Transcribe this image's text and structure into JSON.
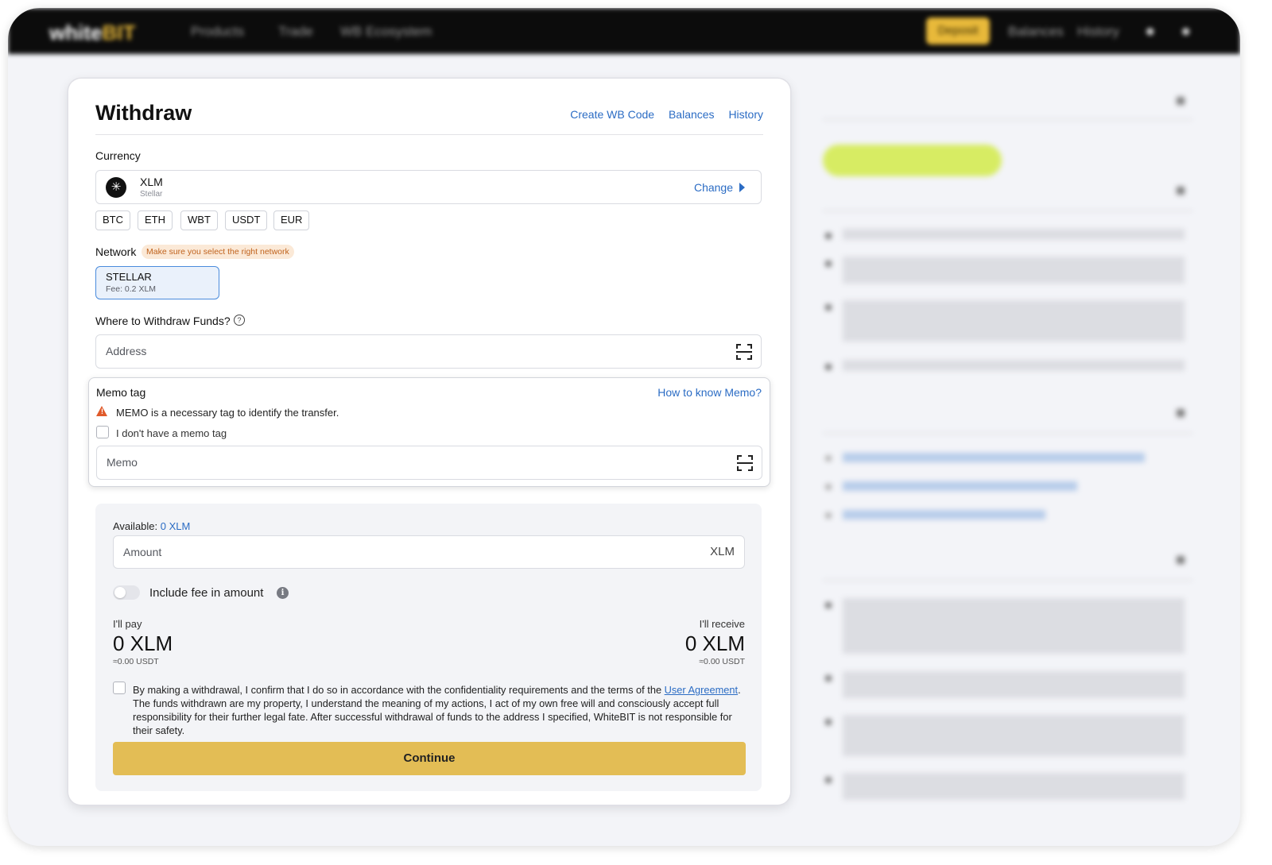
{
  "nav": {
    "logo_white": "white",
    "logo_bit": "BIT",
    "products": "Products",
    "trade": "Trade",
    "ecosystem": "WB Ecosystem",
    "deposit": "Deposit",
    "balances": "Balances",
    "history": "History"
  },
  "withdraw": {
    "title": "Withdraw",
    "links": [
      "Create WB Code",
      "Balances",
      "History"
    ],
    "currency_label": "Currency",
    "currency_code": "XLM",
    "currency_name": "Stellar",
    "change_label": "Change",
    "quick_chips": [
      "BTC",
      "ETH",
      "WBT",
      "USDT",
      "EUR"
    ],
    "network_label": "Network",
    "network_warning": "Make sure you select the right network",
    "network_name": "STELLAR",
    "network_fee": "Fee: 0.2 XLM",
    "where_label": "Where to Withdraw Funds?",
    "address_placeholder": "Address"
  },
  "memo": {
    "title": "Memo tag",
    "how_link": "How to know Memo?",
    "warning": "MEMO is a necessary tag to identify the transfer.",
    "no_memo_label": "I don't have a memo tag",
    "placeholder": "Memo"
  },
  "amount": {
    "available_label": "Available:",
    "available_value": "0 XLM",
    "placeholder": "Amount",
    "unit": "XLM",
    "fee_toggle_label": "Include fee in amount",
    "pay_label": "I'll pay",
    "pay_value": "0 XLM",
    "pay_usdt": "≈0.00 USDT",
    "receive_label": "I'll receive",
    "receive_value": "0 XLM",
    "receive_usdt": "≈0.00 USDT",
    "agreement_pre": "By making a withdrawal, I confirm that I do so in accordance with the confidentiality requirements and the terms of the ",
    "agreement_link": "User Agreement",
    "agreement_post": ". The funds withdrawn are my property, I understand the meaning of my actions, I act of my own free will and consciously accept full responsibility for their further legal fate. After successful withdrawal of funds to the address I specified, WhiteBIT is not responsible for their safety.",
    "continue_label": "Continue"
  },
  "colors": {
    "accent_blue": "#2b6cc4",
    "continue_yellow": "#e3bd55",
    "warning_orange": "#e05a2a"
  }
}
